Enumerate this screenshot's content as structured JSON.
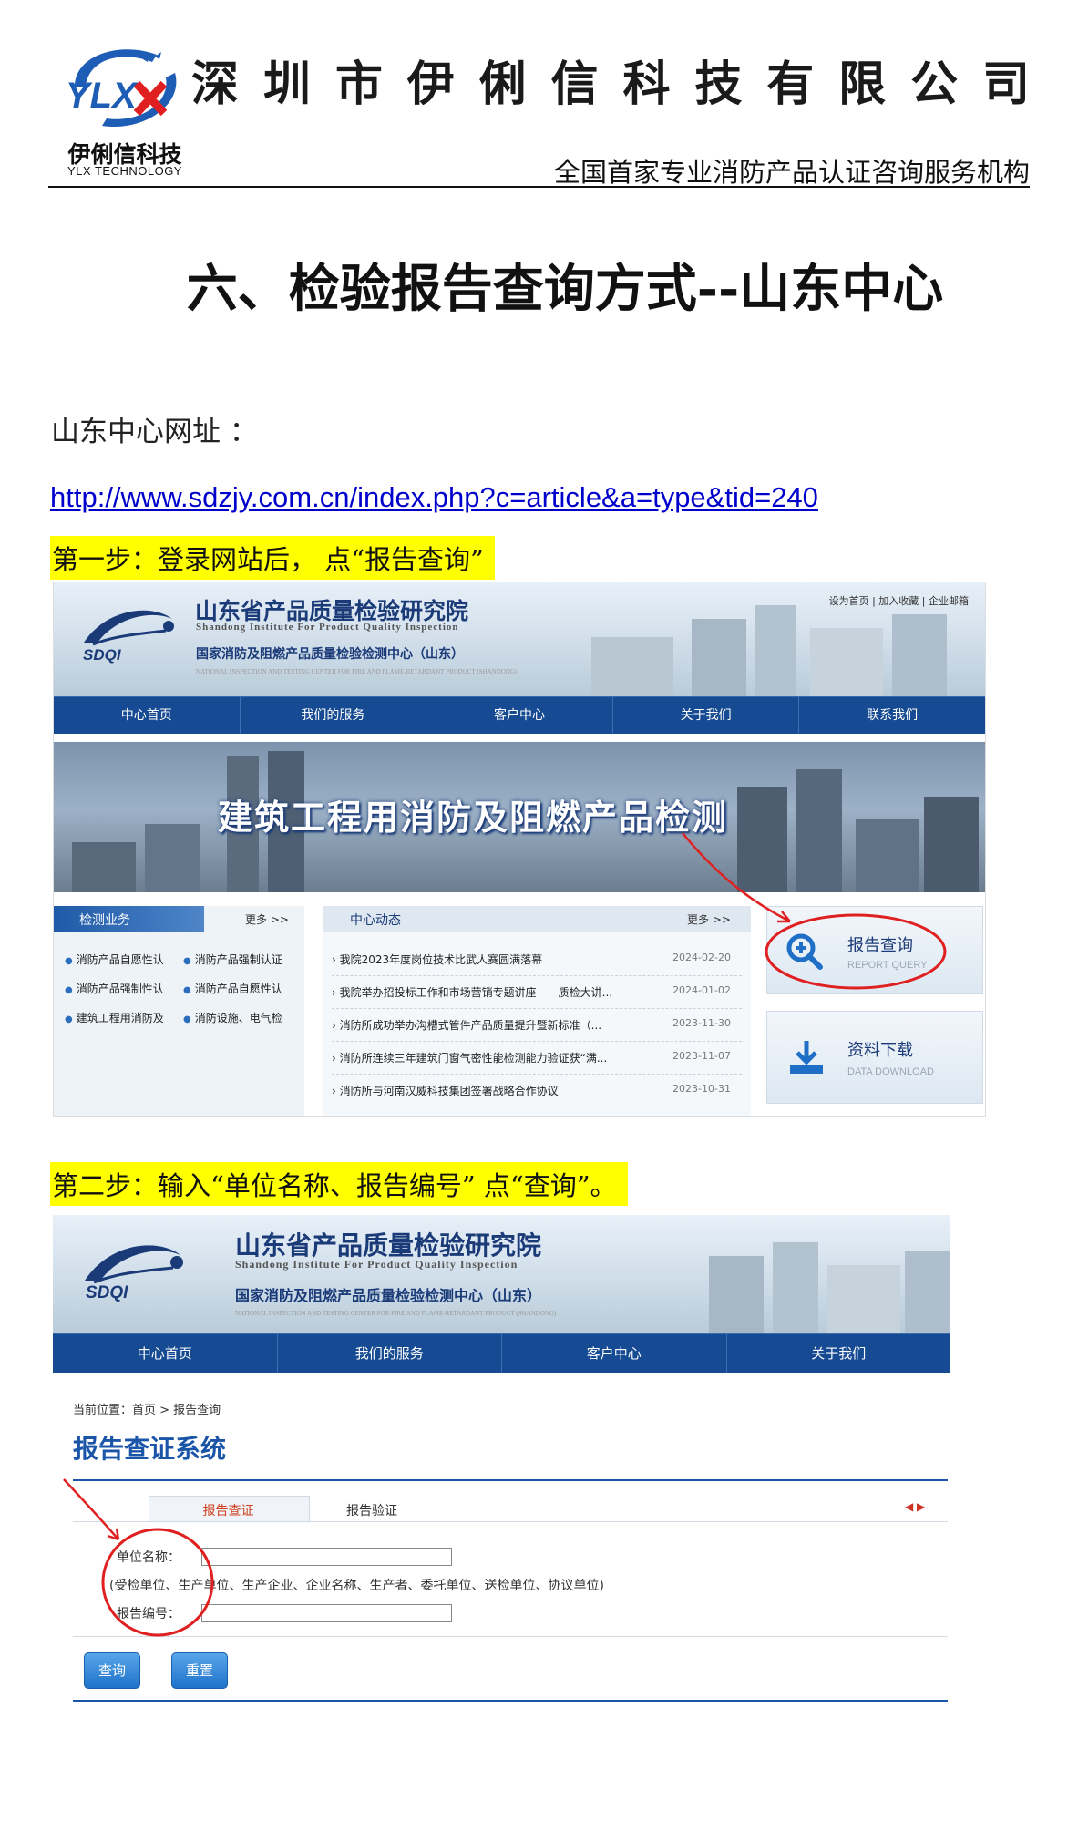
{
  "letterhead": {
    "logo_mark": "YLX",
    "logo_cn": "伊俐信科技",
    "logo_en": "YLX TECHNOLOGY",
    "company_chars": [
      "深",
      "圳",
      "市",
      "伊",
      "俐",
      "信",
      "科",
      "技",
      "有",
      "限",
      "公",
      "司"
    ],
    "tagline": "全国首家专业消防产品认证咨询服务机构"
  },
  "doc": {
    "title": "六、检验报告查询方式--山东中心",
    "url_label": "山东中心网址 ：",
    "url": "http://www.sdzjy.com.cn/index.php?c=article&a=type&tid=240",
    "step1": "第一步：登录网站后， 点“报告查询”",
    "step2": "第二步：输入“单位名称、报告编号” 点“查询”。"
  },
  "site": {
    "logo_text": "SDQI",
    "name_cn": "山东省产品质量检验研究院",
    "name_en": "Shandong Institute For Product Quality Inspection",
    "sub_cn": "国家消防及阻燃产品质量检验检测中心（山东）",
    "sub_en": "NATIONAL INSPECTION AND TESTING CENTER FOR FIRE AND FLAME-RETARDANT PRODUCT (SHANDONG)",
    "top_links": "设为首页 | 加入收藏 | 企业邮箱"
  },
  "shot1": {
    "nav": [
      "中心首页",
      "我们的服务",
      "客户中心",
      "关于我们",
      "联系我们"
    ],
    "hero": "建筑工程用消防及阻燃产品检测",
    "biz_title": "检测业务",
    "more": "更多 >>",
    "biz_items": [
      "消防产品自愿性认",
      "消防产品强制认证",
      "消防产品强制性认",
      "消防产品自愿性认",
      "建筑工程用消防及",
      "消防设施、电气检"
    ],
    "news_title": "中心动态",
    "news": [
      {
        "title": "我院2023年度岗位技术比武人赛圆满落幕",
        "date": "2024-02-20"
      },
      {
        "title": "我院举办招投标工作和市场营销专题讲座——质检大讲...",
        "date": "2024-01-02"
      },
      {
        "title": "消防所成功举办沟槽式管件产品质量提升暨新标准（...",
        "date": "2023-11-30"
      },
      {
        "title": "消防所连续三年建筑门窗气密性能检测能力验证获“满...",
        "date": "2023-11-07"
      },
      {
        "title": "消防所与河南汉威科技集团签署战略合作协议",
        "date": "2023-10-31"
      }
    ],
    "report_cn": "报告查询",
    "report_en": "REPORT QUERY",
    "download_cn": "资料下载",
    "download_en": "DATA DOWNLOAD"
  },
  "shot2": {
    "nav": [
      "中心首页",
      "我们的服务",
      "客户中心",
      "关于我们"
    ],
    "breadcrumb": "当前位置：首页 > 报告查询",
    "system_title": "报告查证系统",
    "tab_active": "报告查证",
    "tab_other": "报告验证",
    "unit_label": "单位名称：",
    "unit_value": "",
    "hint": "(受检单位、生产单位、生产企业、企业名称、生产者、委托单位、送检单位、协议单位)",
    "report_label": "报告编号：",
    "report_value": "",
    "query_btn": "查询",
    "reset_btn": "重置"
  },
  "colors": {
    "nav": "#164a92",
    "highlight": "#ffff00",
    "link": "#0000cc",
    "annotation": "#e02020",
    "title_blue": "#1a55a8"
  }
}
